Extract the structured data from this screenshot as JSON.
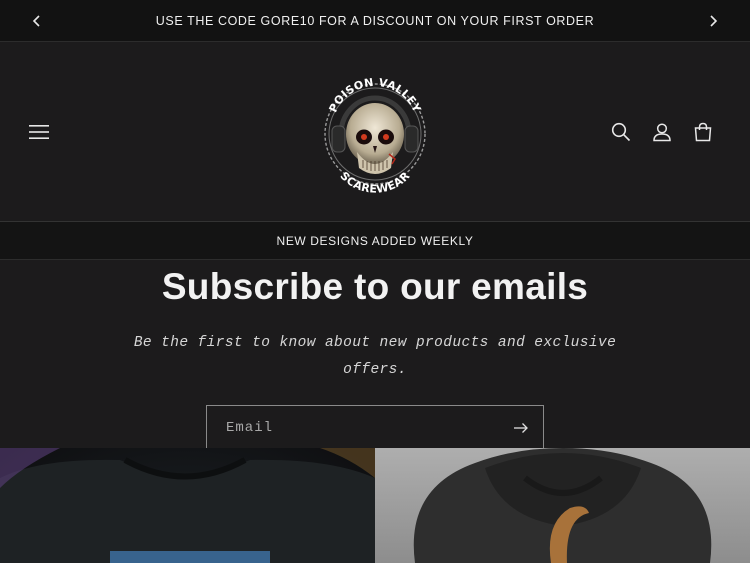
{
  "announcement": {
    "text": "USE THE CODE GORE10 FOR A DISCOUNT ON YOUR FIRST ORDER",
    "prev_icon": "chevron-left-icon",
    "next_icon": "chevron-right-icon"
  },
  "header": {
    "menu_icon": "hamburger-icon",
    "logo": {
      "top_text": "POISON VALLEY",
      "bottom_text": "SCAREWEAR"
    },
    "icons": [
      "search-icon",
      "account-icon",
      "cart-icon"
    ]
  },
  "subbar": {
    "text": "NEW DESIGNS ADDED WEEKLY"
  },
  "newsletter": {
    "title": "Subscribe to our emails",
    "subtitle": "Be the first to know about new products and exclusive offers.",
    "email_placeholder": "Email",
    "submit_icon": "arrow-right-icon"
  },
  "colors": {
    "background": "#1c1b1c",
    "announcement_bg": "#121212",
    "text": "#ececec"
  }
}
